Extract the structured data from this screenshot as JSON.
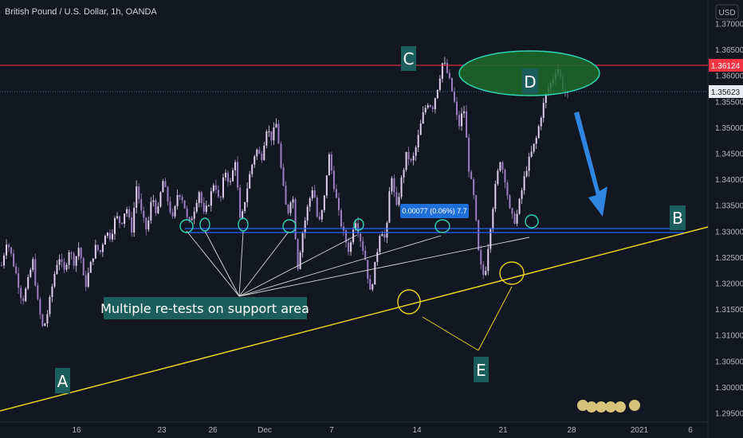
{
  "header": {
    "symbol_title": "British Pound / U.S. Dollar, 1h, OANDA",
    "currency": "USD"
  },
  "colors": {
    "background": "#131722",
    "candle": "#9c7fbf",
    "candle_light": "#e0cfee",
    "resistance_line": "#f23645",
    "support_lines": "#2962ff",
    "trendline": "#e8d21c",
    "label_box": "#1b5e5b",
    "arrow": "#2f86e0",
    "ellipse_fill": "#1f6b2a",
    "ellipse_stroke": "#2fd6b5"
  },
  "chart_data": {
    "type": "line",
    "title": "British Pound / U.S. Dollar, 1h, OANDA",
    "ylabel": "USD",
    "ylim": [
      1.293,
      1.371
    ],
    "y_ticks": [
      "1.37000",
      "1.36500",
      "1.36000",
      "1.35500",
      "1.35000",
      "1.34500",
      "1.34000",
      "1.33500",
      "1.33000",
      "1.32500",
      "1.32000",
      "1.31500",
      "1.31000",
      "1.30500",
      "1.30000",
      "1.29500"
    ],
    "x_ticks": [
      "16",
      "23",
      "26",
      "Dec",
      "7",
      "14",
      "21",
      "28",
      "2021",
      "6"
    ],
    "series": [
      {
        "values": [
          1.3235,
          1.3285,
          1.325,
          1.321,
          1.3165,
          1.32,
          1.3245,
          1.316,
          1.311,
          1.315,
          1.321,
          1.3255,
          1.322,
          1.3265,
          1.324,
          1.3275,
          1.319,
          1.323,
          1.327,
          1.326,
          1.33,
          1.329,
          1.333,
          1.3315,
          1.335,
          1.33,
          1.339,
          1.333,
          1.33,
          1.337,
          1.333,
          1.34,
          1.336,
          1.332,
          1.338,
          1.336,
          1.331,
          1.334,
          1.338,
          1.333,
          1.336,
          1.34,
          1.335,
          1.342,
          1.339,
          1.344,
          1.331,
          1.337,
          1.342,
          1.346,
          1.344,
          1.35,
          1.348,
          1.351,
          1.34,
          1.333,
          1.338,
          1.323,
          1.33,
          1.335,
          1.339,
          1.331,
          1.335,
          1.345,
          1.339,
          1.333,
          1.329,
          1.326,
          1.333,
          1.329,
          1.325,
          1.318,
          1.324,
          1.331,
          1.328,
          1.342,
          1.334,
          1.34,
          1.345,
          1.343,
          1.347,
          1.352,
          1.355,
          1.354,
          1.358,
          1.363,
          1.36,
          1.356,
          1.35,
          1.354,
          1.342,
          1.336,
          1.324,
          1.321,
          1.33,
          1.338,
          1.344,
          1.34,
          1.333,
          1.332,
          1.337,
          1.342,
          1.345,
          1.348,
          1.353,
          1.357,
          1.359,
          1.362,
          1.358,
          1.356
        ]
      }
    ],
    "resistance_level": 1.36124,
    "current_price": 1.35623,
    "support_level": 1.3298,
    "measure": "0.00077 (0.06%) 7.7",
    "grid": false,
    "legend": "none"
  },
  "annotations": {
    "label_a": "A",
    "label_b": "B",
    "label_c": "C",
    "label_d": "D",
    "label_e": "E",
    "support_note": "Multiple re-tests on support area",
    "resistance_price_tag": "1.36124",
    "current_price_tag": "1.35623"
  }
}
